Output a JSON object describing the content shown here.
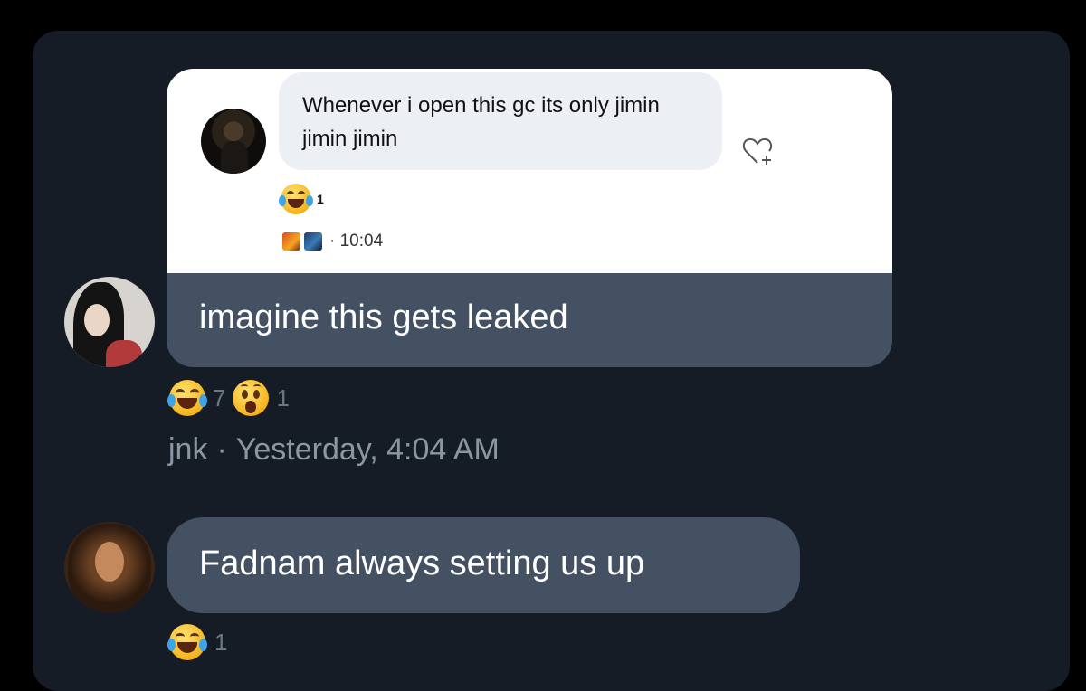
{
  "quoted": {
    "text": "Whenever i open this gc its only jimin jimin jimin",
    "reaction_count": "1",
    "time": "· 10:04"
  },
  "message1": {
    "text": "imagine this gets leaked",
    "reactions": [
      {
        "emoji": "laugh-cry",
        "count": "7"
      },
      {
        "emoji": "astonished",
        "count": "1"
      }
    ],
    "sender": "jnk",
    "separator": "·",
    "timestamp": "Yesterday, 4:04 AM"
  },
  "message2": {
    "text": "Fadnam always setting us up",
    "reactions": [
      {
        "emoji": "laugh-cry",
        "count": "1"
      }
    ]
  },
  "colors": {
    "background": "#000000",
    "panel": "#161c26",
    "bubble": "#445163",
    "meta_text": "#8b96a3"
  }
}
